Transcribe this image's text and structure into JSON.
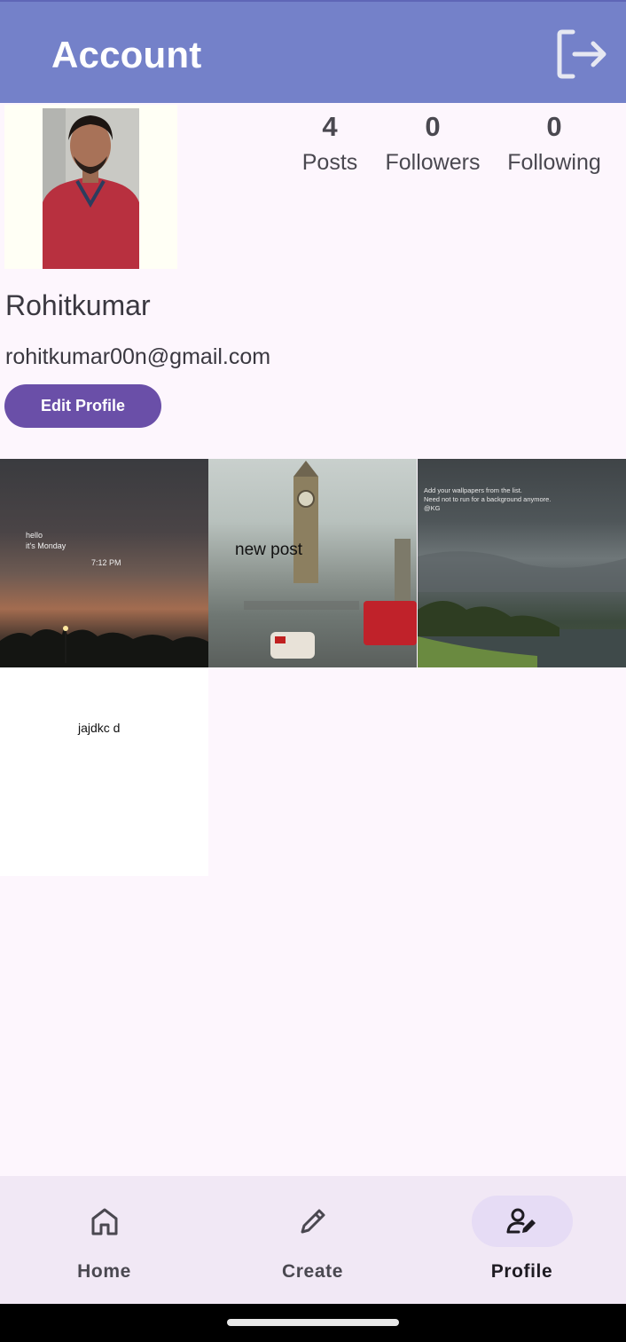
{
  "app_bar": {
    "title": "Account",
    "logout_icon": "logout-icon"
  },
  "profile": {
    "name": "Rohitkumar",
    "email": "rohitkumar00n@gmail.com",
    "edit_button_label": "Edit Profile"
  },
  "stats": [
    {
      "value": "4",
      "label": "Posts"
    },
    {
      "value": "0",
      "label": "Followers"
    },
    {
      "value": "0",
      "label": "Following"
    }
  ],
  "posts": [
    {
      "line1": "hello\nit's Monday",
      "time": "7:12 PM"
    },
    {
      "caption": "new post"
    },
    {
      "overlay": "Add your wallpapers from the list.\nNeed not to run for a background anymore.\n@KG"
    },
    {
      "caption": "jajdkc d"
    }
  ],
  "bottom_nav": {
    "items": [
      {
        "label": "Home",
        "icon": "home-icon",
        "active": false
      },
      {
        "label": "Create",
        "icon": "pencil-icon",
        "active": false
      },
      {
        "label": "Profile",
        "icon": "profile-edit-icon",
        "active": true
      }
    ]
  },
  "colors": {
    "app_bar": "#7481c9",
    "accent": "#6a4fa8",
    "background": "#fdf6fd",
    "nav_background": "#f1e8f5"
  }
}
